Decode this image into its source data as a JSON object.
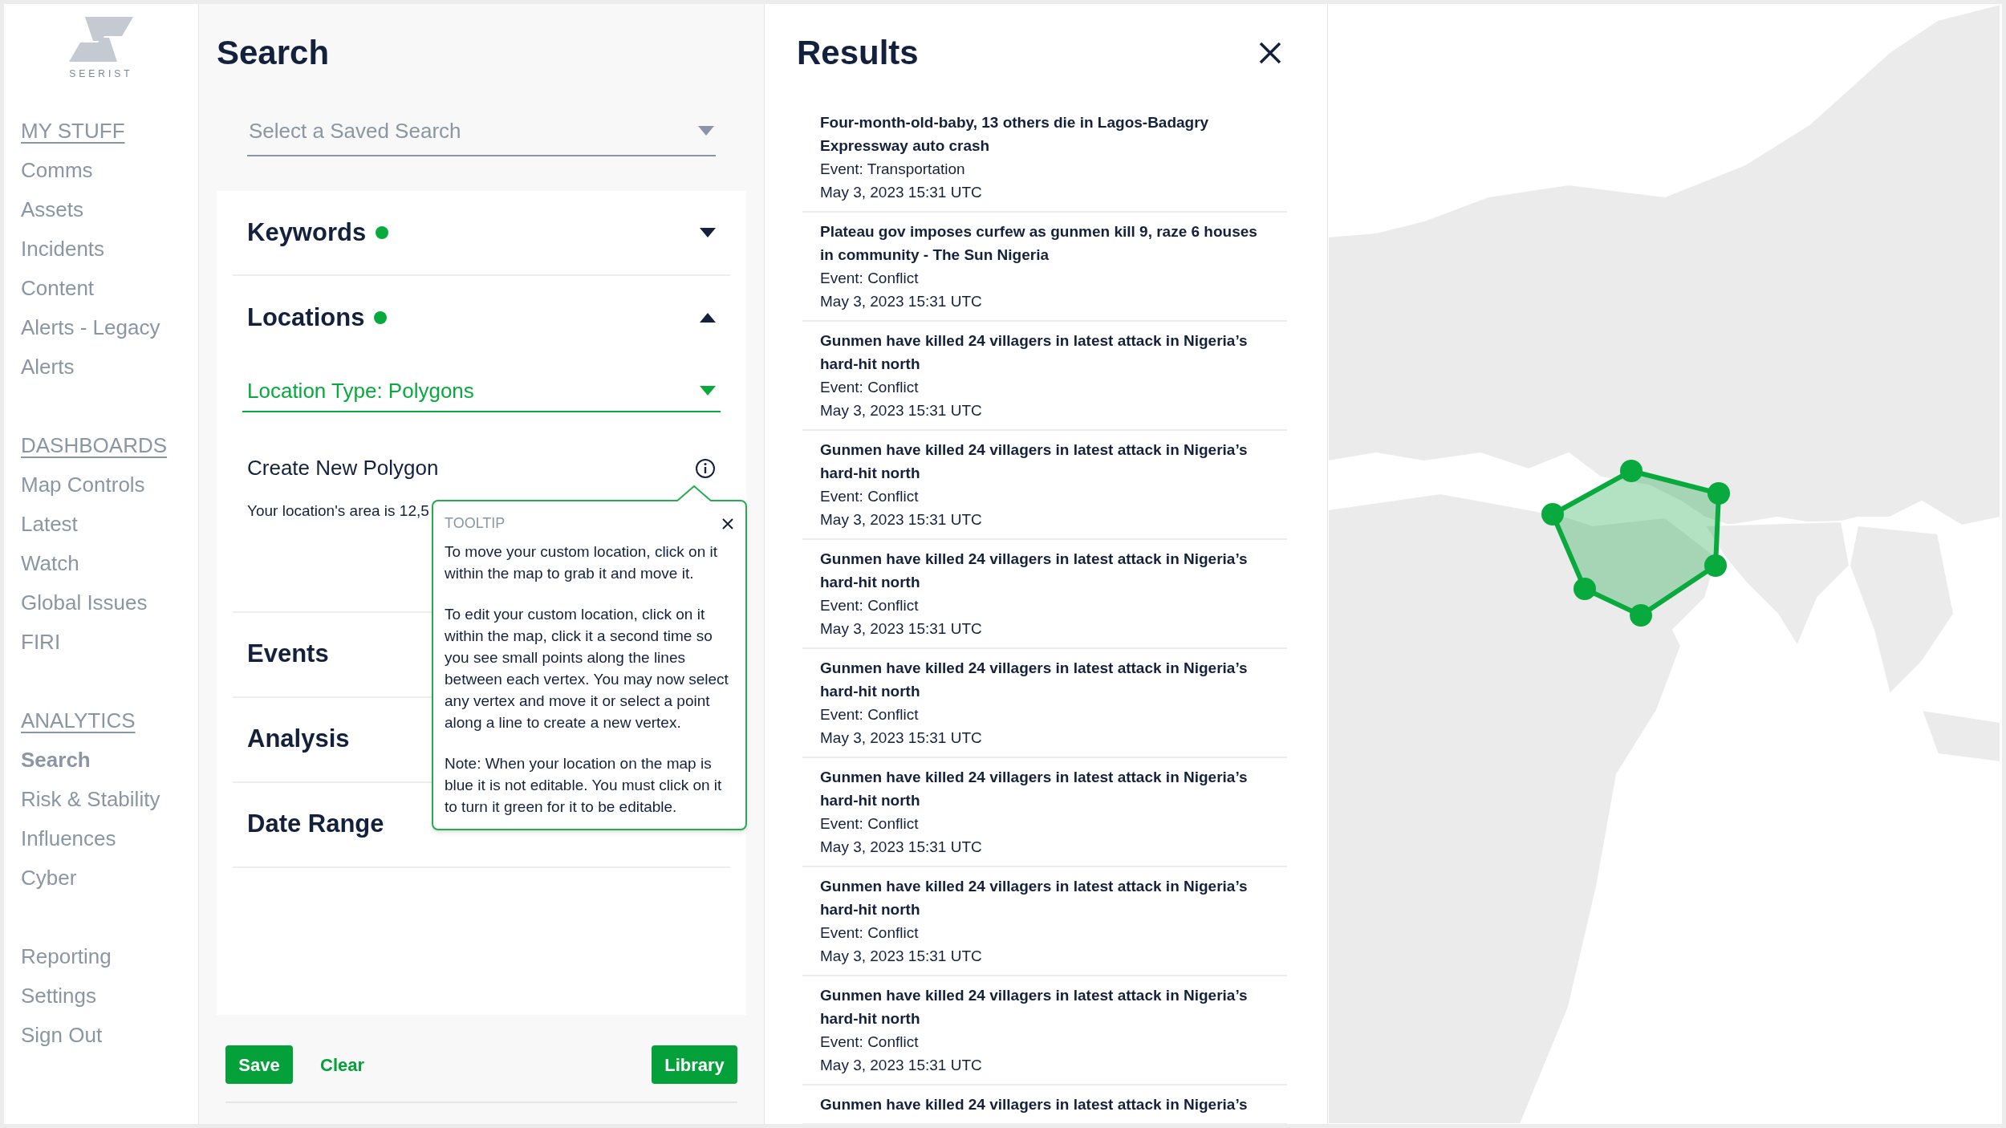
{
  "sidebar": {
    "logo_text": "SEERIST",
    "groups": [
      {
        "heading": "MY STUFF",
        "items": [
          {
            "label": "Comms",
            "selected": false
          },
          {
            "label": "Assets",
            "selected": false
          },
          {
            "label": "Incidents",
            "selected": false
          },
          {
            "label": "Content",
            "selected": false
          },
          {
            "label": "Alerts - Legacy",
            "selected": false
          },
          {
            "label": "Alerts",
            "selected": false
          }
        ]
      },
      {
        "heading": "DASHBOARDS",
        "items": [
          {
            "label": "Map Controls",
            "selected": false
          },
          {
            "label": "Latest",
            "selected": false
          },
          {
            "label": "Watch",
            "selected": false
          },
          {
            "label": "Global Issues",
            "selected": false
          },
          {
            "label": "FIRI",
            "selected": false
          }
        ]
      },
      {
        "heading": "ANALYTICS",
        "items": [
          {
            "label": "Search",
            "selected": true
          },
          {
            "label": "Risk & Stability",
            "selected": false
          },
          {
            "label": "Influences",
            "selected": false
          },
          {
            "label": "Cyber",
            "selected": false
          }
        ]
      },
      {
        "items": [
          {
            "label": "Reporting",
            "selected": false
          },
          {
            "label": "Settings",
            "selected": false
          },
          {
            "label": "Sign Out",
            "selected": false
          }
        ]
      }
    ]
  },
  "search": {
    "title": "Search",
    "saved_search": {
      "placeholder": "Select a Saved Search"
    },
    "sections": [
      {
        "title": "Keywords",
        "has_filters": true,
        "expanded": false
      },
      {
        "title": "Locations",
        "has_filters": true,
        "expanded": true,
        "location_type": "Location Type: Polygons",
        "create_label": "Create New Polygon",
        "area_text": "Your location's area is 12,5"
      },
      {
        "title": "Events",
        "has_filters": false
      },
      {
        "title": "Analysis",
        "has_filters": false
      },
      {
        "title": "Date Range",
        "has_filters": false
      }
    ],
    "tooltip": {
      "heading": "TOOLTIP",
      "paragraphs": [
        "To move your custom location, click on it within the map to grab it and move it.",
        "To edit your custom location, click on it within the map, click it a second time so you see small points along the lines between each vertex. You may now select any vertex and move it or select a point along a line to create a new vertex.",
        "Note: When your location on the map is blue it is not editable. You must click on it to turn it green for it to be editable."
      ]
    },
    "buttons": {
      "save": "Save",
      "clear": "Clear",
      "library": "Library"
    }
  },
  "results": {
    "title": "Results",
    "items": [
      {
        "title": "Four-month-old-baby, 13 others die in Lagos-Badagry Expressway auto crash",
        "event": "Event: Transportation",
        "time": "May 3, 2023 15:31 UTC"
      },
      {
        "title": "Plateau gov imposes curfew as gunmen kill 9, raze 6 houses in community - The Sun Nigeria",
        "event": "Event: Conflict",
        "time": "May 3, 2023 15:31 UTC"
      },
      {
        "title": "Gunmen have killed 24 villagers in latest attack in Nigeria’s hard-hit north",
        "event": "Event: Conflict",
        "time": "May 3, 2023 15:31 UTC"
      },
      {
        "title": "Gunmen have killed 24 villagers in latest attack in Nigeria’s hard-hit north",
        "event": "Event: Conflict",
        "time": "May 3, 2023 15:31 UTC"
      },
      {
        "title": "Gunmen have killed 24 villagers in latest attack in Nigeria’s hard-hit north",
        "event": "Event: Conflict",
        "time": "May 3, 2023 15:31 UTC"
      },
      {
        "title": "Gunmen have killed 24 villagers in latest attack in Nigeria’s hard-hit north",
        "event": "Event: Conflict",
        "time": "May 3, 2023 15:31 UTC"
      },
      {
        "title": "Gunmen have killed 24 villagers in latest attack in Nigeria’s hard-hit north",
        "event": "Event: Conflict",
        "time": "May 3, 2023 15:31 UTC"
      },
      {
        "title": "Gunmen have killed 24 villagers in latest attack in Nigeria’s hard-hit north",
        "event": "Event: Conflict",
        "time": "May 3, 2023 15:31 UTC"
      },
      {
        "title": "Gunmen have killed 24 villagers in latest attack in Nigeria’s hard-hit north",
        "event": "Event: Conflict",
        "time": "May 3, 2023 15:31 UTC"
      },
      {
        "title": "Gunmen have killed 24 villagers in latest attack in Nigeria’s"
      }
    ]
  }
}
